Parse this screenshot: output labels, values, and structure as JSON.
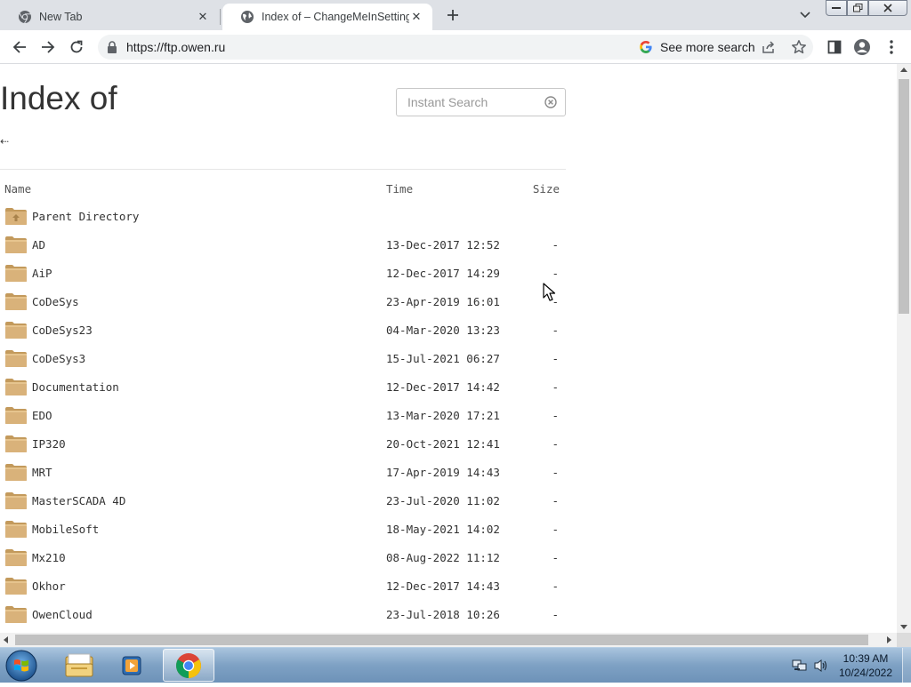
{
  "browser": {
    "tabs": [
      {
        "title": "New Tab",
        "active": false,
        "icon": "chrome-icon"
      },
      {
        "title": "Index of – ChangeMeInSettings",
        "active": true,
        "icon": "globe-icon"
      }
    ],
    "url": "https://ftp.owen.ru",
    "omnibox_chip": "See more search",
    "accent_color": "#1a73e8"
  },
  "page": {
    "heading": "Index of",
    "search_placeholder": "Instant Search",
    "back_link": "⇠",
    "columns": {
      "name": "Name",
      "time": "Time",
      "size": "Size"
    },
    "parent_directory": "Parent Directory",
    "entries": [
      {
        "name": "AD",
        "time": "13-Dec-2017 12:52",
        "size": "-"
      },
      {
        "name": "AiP",
        "time": "12-Dec-2017 14:29",
        "size": "-"
      },
      {
        "name": "CoDeSys",
        "time": "23-Apr-2019 16:01",
        "size": "-"
      },
      {
        "name": "CoDeSys23",
        "time": "04-Mar-2020 13:23",
        "size": "-"
      },
      {
        "name": "CoDeSys3",
        "time": "15-Jul-2021 06:27",
        "size": "-"
      },
      {
        "name": "Documentation",
        "time": "12-Dec-2017 14:42",
        "size": "-"
      },
      {
        "name": "EDO",
        "time": "13-Mar-2020 17:21",
        "size": "-"
      },
      {
        "name": "IP320",
        "time": "20-Oct-2021 12:41",
        "size": "-"
      },
      {
        "name": "MRT",
        "time": "17-Apr-2019 14:43",
        "size": "-"
      },
      {
        "name": "MasterSCADA 4D",
        "time": "23-Jul-2020 11:02",
        "size": "-"
      },
      {
        "name": "MobileSoft",
        "time": "18-May-2021 14:02",
        "size": "-"
      },
      {
        "name": "Mx210",
        "time": "08-Aug-2022 11:12",
        "size": "-"
      },
      {
        "name": "Okhor",
        "time": "12-Dec-2017 14:43",
        "size": "-"
      },
      {
        "name": "OwenCloud",
        "time": "23-Jul-2018 10:26",
        "size": "-"
      }
    ]
  },
  "taskbar": {
    "apps": [
      "windows-explorer-icon",
      "media-player-icon",
      "chrome-icon"
    ],
    "active_app": "chrome-icon",
    "time": "10:39 AM",
    "date": "10/24/2022"
  }
}
